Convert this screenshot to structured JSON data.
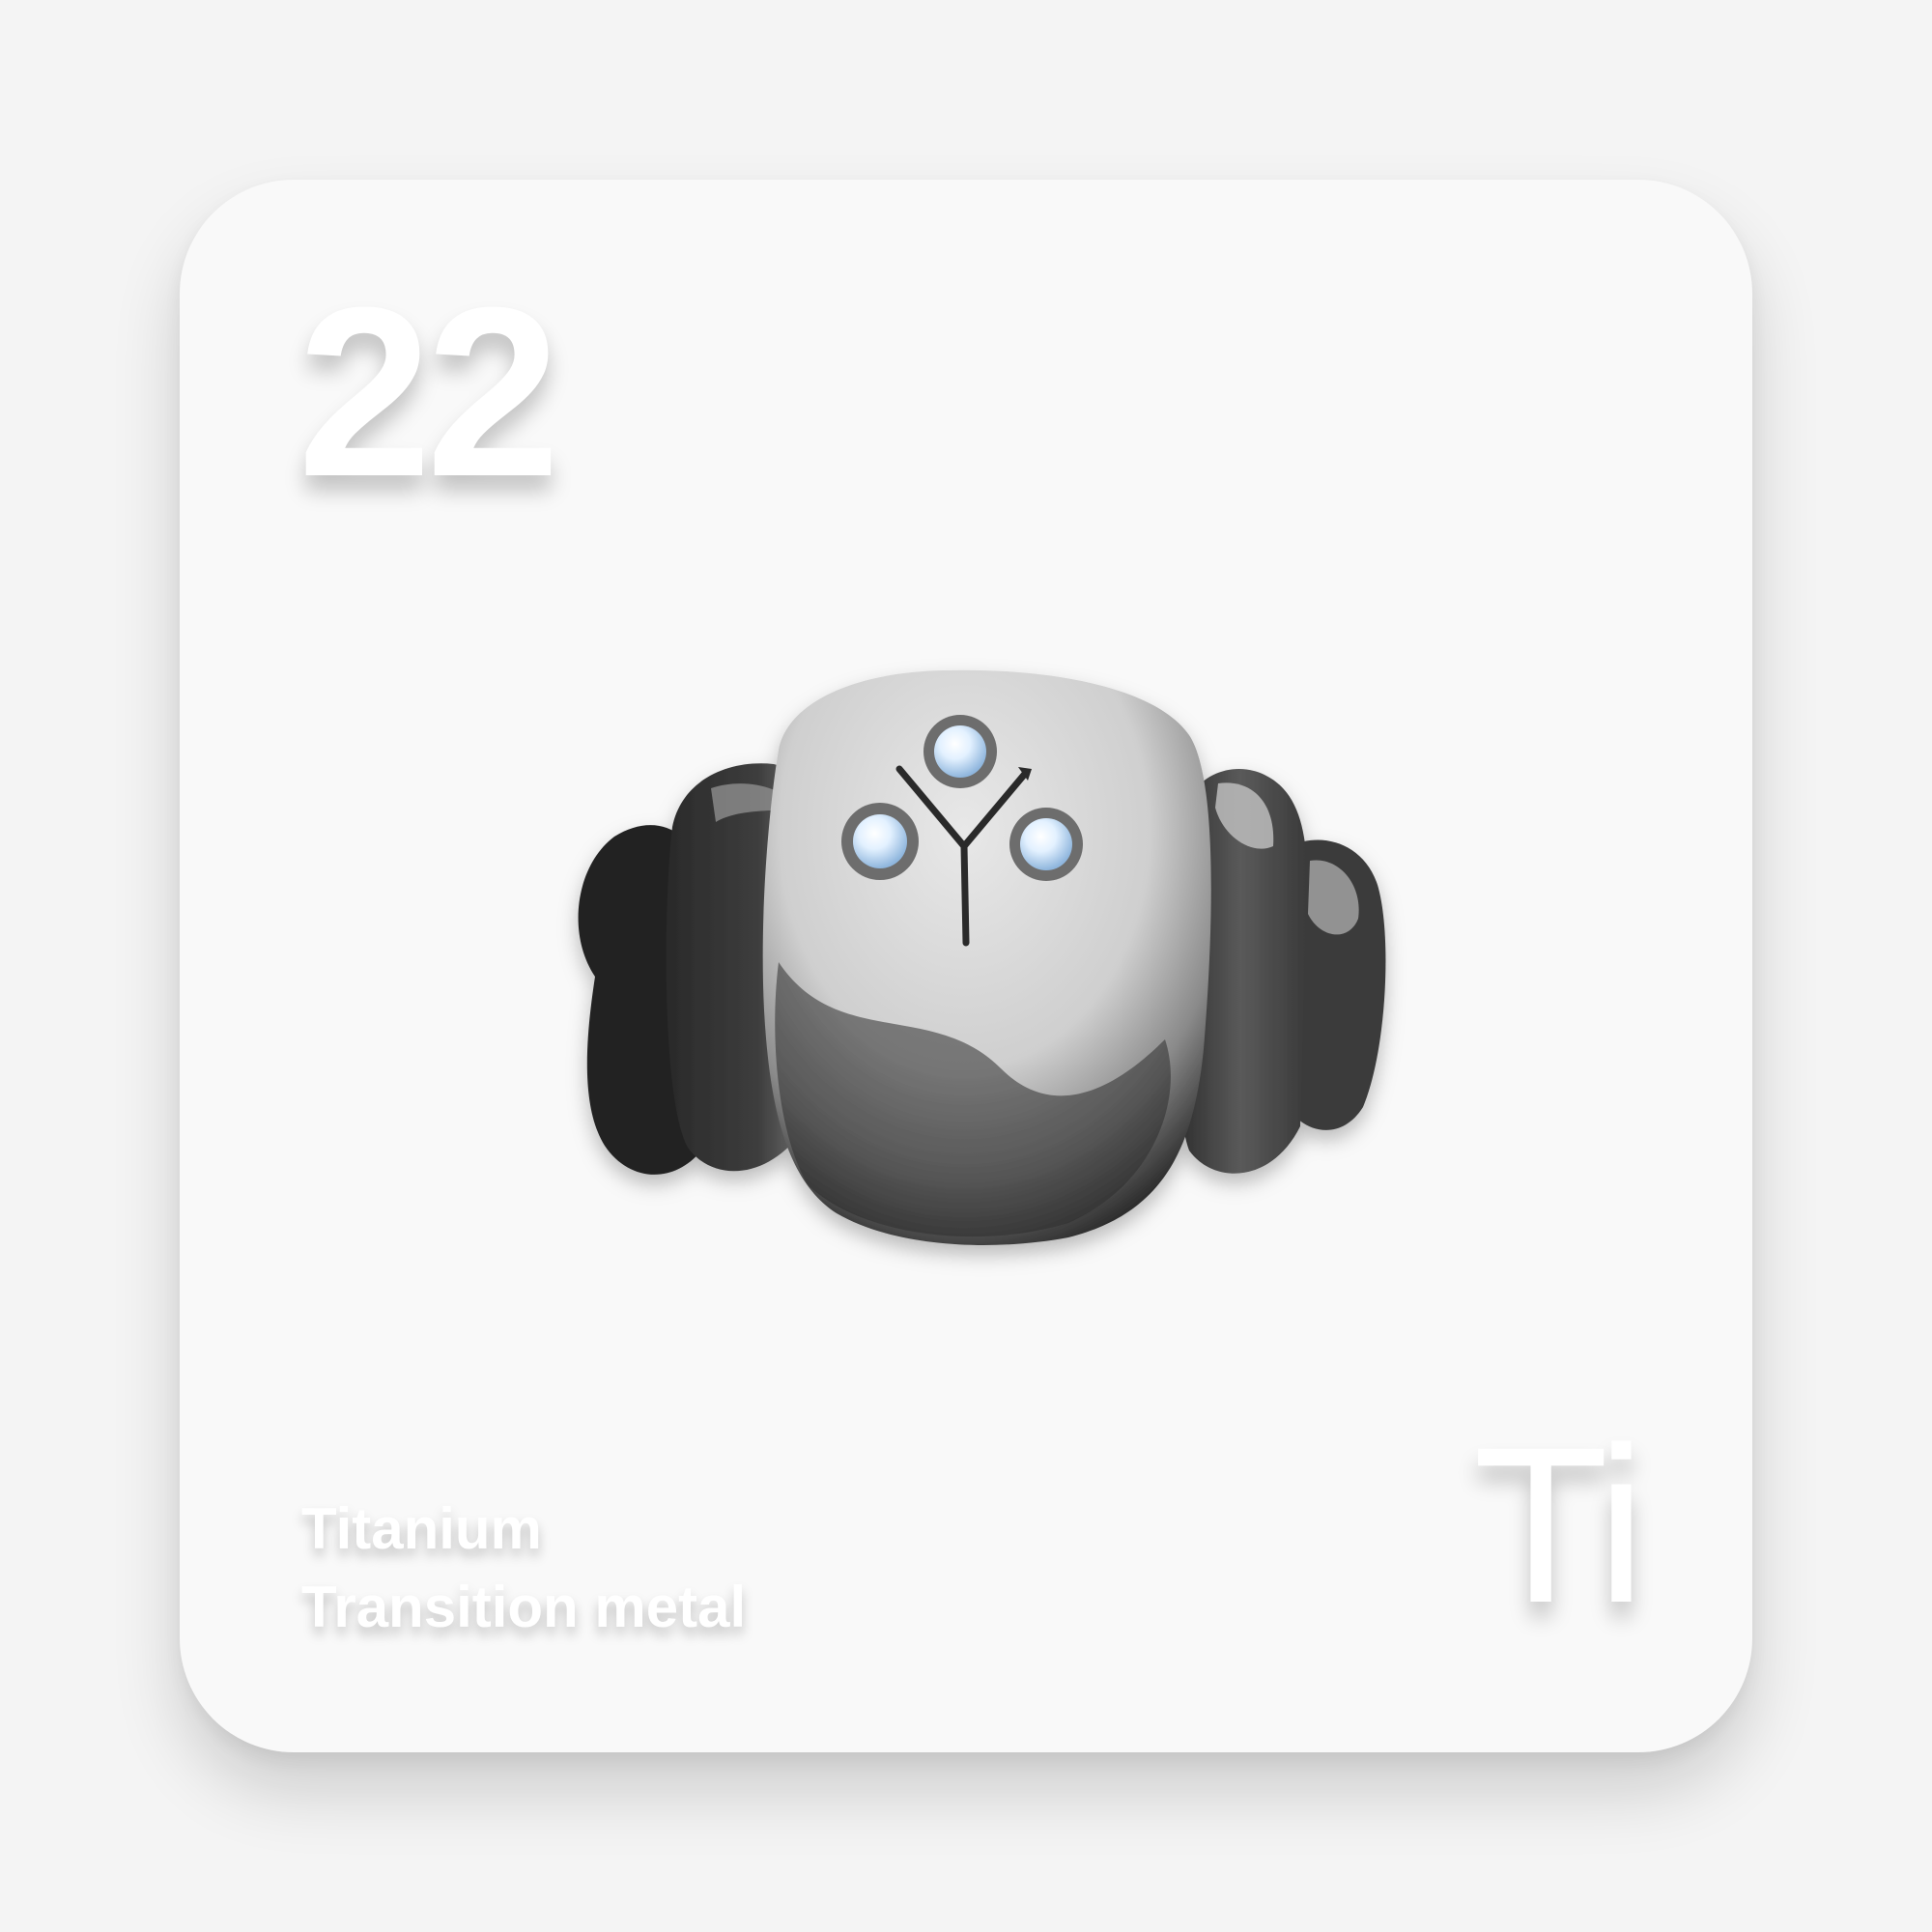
{
  "element": {
    "atomic_number": "22",
    "symbol": "Ti",
    "name": "Titanium",
    "category": "Transition metal"
  },
  "illustration": {
    "subject": "stone-golem-icon"
  },
  "colors": {
    "page_background": "#f4f4f4",
    "card_background": "#f9f9f9",
    "text": "#ffffff",
    "rock_dark": "#2b2b2b",
    "rock_light": "#d8d8d8",
    "gem": "#cfe6ff"
  }
}
